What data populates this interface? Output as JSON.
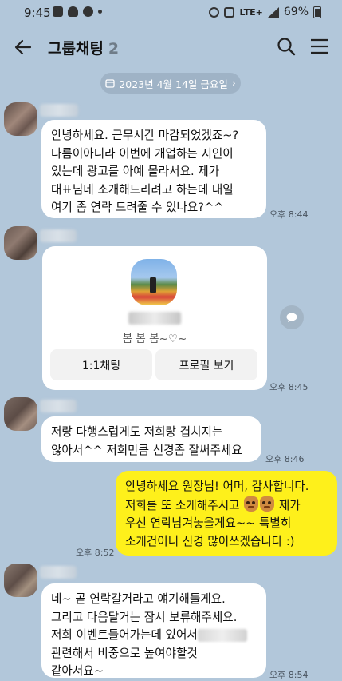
{
  "status_bar": {
    "time": "9:45",
    "network": "LTE+",
    "battery": "69%"
  },
  "header": {
    "title": "그룹채팅",
    "member_count": "2"
  },
  "date_chip": "2023년 4월 14일 금요일",
  "messages": [
    {
      "text": "안녕하세요. 근무시간 마감되었겠죠~?\n다름이아니라  이번에 개업하는 지인이\n있는데 광고를 아예 몰라서요. 제가\n대표님네 소개해드리려고 하는데 내일\n여기 좀 연락 드려줄 수 있나요?^^",
      "time": "오후 8:44"
    },
    {
      "time": "오후 8:45"
    },
    {
      "text": "저랑 다행스럽게도 저희랑 겹치지는\n않아서^^ 저희만큼 신경좀 잘써주세요",
      "time": "오후 8:46"
    },
    {
      "line1": "안녕하세요 원장님! 어머, 감사합니다.",
      "line2a": "저희를 또 소개해주시고 ",
      "line2b": " 제가",
      "line3": "우선 연락남겨놓을게요~~ 특별히",
      "line4": "소개건이니 신경 많이쓰겠습니다 :)",
      "time": "오후 8:52"
    },
    {
      "line1": "네~ 곧 연락갈거라고 얘기해둘게요.",
      "line2": "그리고 다음달거는 잠시 보류해주세요.",
      "line3": "저희 이벤트들어가는데 있어서",
      "line4": "관련해서 비중으로 높여야할것",
      "line5": "같아서요~",
      "time": "오후 8:54"
    }
  ],
  "profile_card": {
    "status": "봄 봄 봄~♡~",
    "chat_button": "1:1채팅",
    "profile_button": "프로필 보기"
  },
  "colors": {
    "background": "#b2c7da",
    "my_bubble": "#fef01b",
    "other_bubble": "#ffffff"
  }
}
